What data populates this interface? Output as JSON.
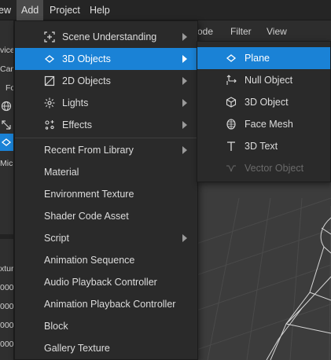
{
  "menubar": {
    "items": [
      {
        "label": "ew",
        "active": false
      },
      {
        "label": "Add",
        "active": true
      },
      {
        "label": "Project",
        "active": false
      },
      {
        "label": "Help",
        "active": false
      }
    ]
  },
  "left_panel": {
    "labels": [
      "vice",
      "Cam",
      "Fo",
      "Micr",
      "xture",
      "0000",
      "0000",
      "0000",
      "0000"
    ]
  },
  "viewport": {
    "tabs": [
      "ode",
      "Filter",
      "View"
    ]
  },
  "add_menu": {
    "items": [
      {
        "label": "Scene Understanding",
        "icon": "scene-understanding-icon",
        "submenu": true
      },
      {
        "label": "3D Objects",
        "icon": "3d-objects-icon",
        "submenu": true,
        "highlighted": true
      },
      {
        "label": "2D Objects",
        "icon": "2d-objects-icon",
        "submenu": true
      },
      {
        "label": "Lights",
        "icon": "lights-icon",
        "submenu": true
      },
      {
        "label": "Effects",
        "icon": "effects-icon",
        "submenu": true
      },
      {
        "label": "Recent From Library",
        "submenu": true
      },
      {
        "label": "Material"
      },
      {
        "label": "Environment Texture"
      },
      {
        "label": "Shader Code Asset"
      },
      {
        "label": "Script",
        "submenu": true
      },
      {
        "label": "Animation Sequence"
      },
      {
        "label": "Audio Playback Controller"
      },
      {
        "label": "Animation Playback Controller"
      },
      {
        "label": "Block"
      },
      {
        "label": "Gallery Texture"
      }
    ]
  },
  "objects_submenu": {
    "items": [
      {
        "label": "Plane",
        "icon": "plane-icon",
        "highlighted": true
      },
      {
        "label": "Null Object",
        "icon": "null-object-icon"
      },
      {
        "label": "3D Object",
        "icon": "cube-icon"
      },
      {
        "label": "Face Mesh",
        "icon": "face-mesh-icon"
      },
      {
        "label": "3D Text",
        "icon": "text-icon"
      },
      {
        "label": "Vector Object",
        "icon": "vector-object-icon",
        "disabled": true
      }
    ]
  },
  "colors": {
    "highlight": "#1a82d6",
    "menu_bg": "#2a2a2a",
    "text": "#dcdcdc",
    "disabled_text": "#6a6a6a"
  }
}
